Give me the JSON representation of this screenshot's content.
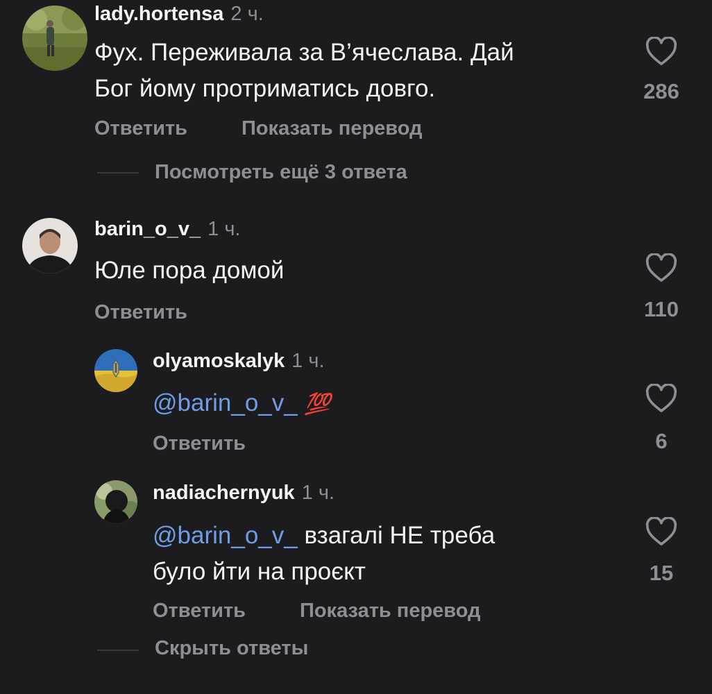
{
  "comments": [
    {
      "username": "lady.hortensa",
      "time": "2 ч.",
      "text_line1": "Фух. Переживала за В’ячеслава. Дай",
      "text_line2": "Бог йому протриматись довго.",
      "likes": "286",
      "reply_label": "Ответить",
      "translate_label": "Показать перевод",
      "more_replies_label": "Посмотреть ещё 3 ответа"
    },
    {
      "username": "barin_o_v_",
      "time": "1 ч.",
      "text": "Юле пора домой",
      "likes": "110",
      "reply_label": "Ответить",
      "replies": [
        {
          "username": "olyamoskalyk",
          "time": "1 ч.",
          "mention": "@barin_o_v_",
          "emoji": "💯",
          "likes": "6",
          "reply_label": "Ответить"
        },
        {
          "username": "nadiachernyuk",
          "time": "1 ч.",
          "mention": "@barin_o_v_",
          "text_line1": "взагалі НЕ треба",
          "text_line2": "було йти на проєкт",
          "likes": "15",
          "reply_label": "Ответить",
          "translate_label": "Показать перевод"
        }
      ],
      "hide_replies_label": "Скрыть ответы"
    }
  ],
  "colors": {
    "background": "#1c1c1e",
    "text": "#f5f5f5",
    "secondary": "#8e8e93",
    "mention": "#6f9de6",
    "emoji_100": "#e0302c"
  }
}
